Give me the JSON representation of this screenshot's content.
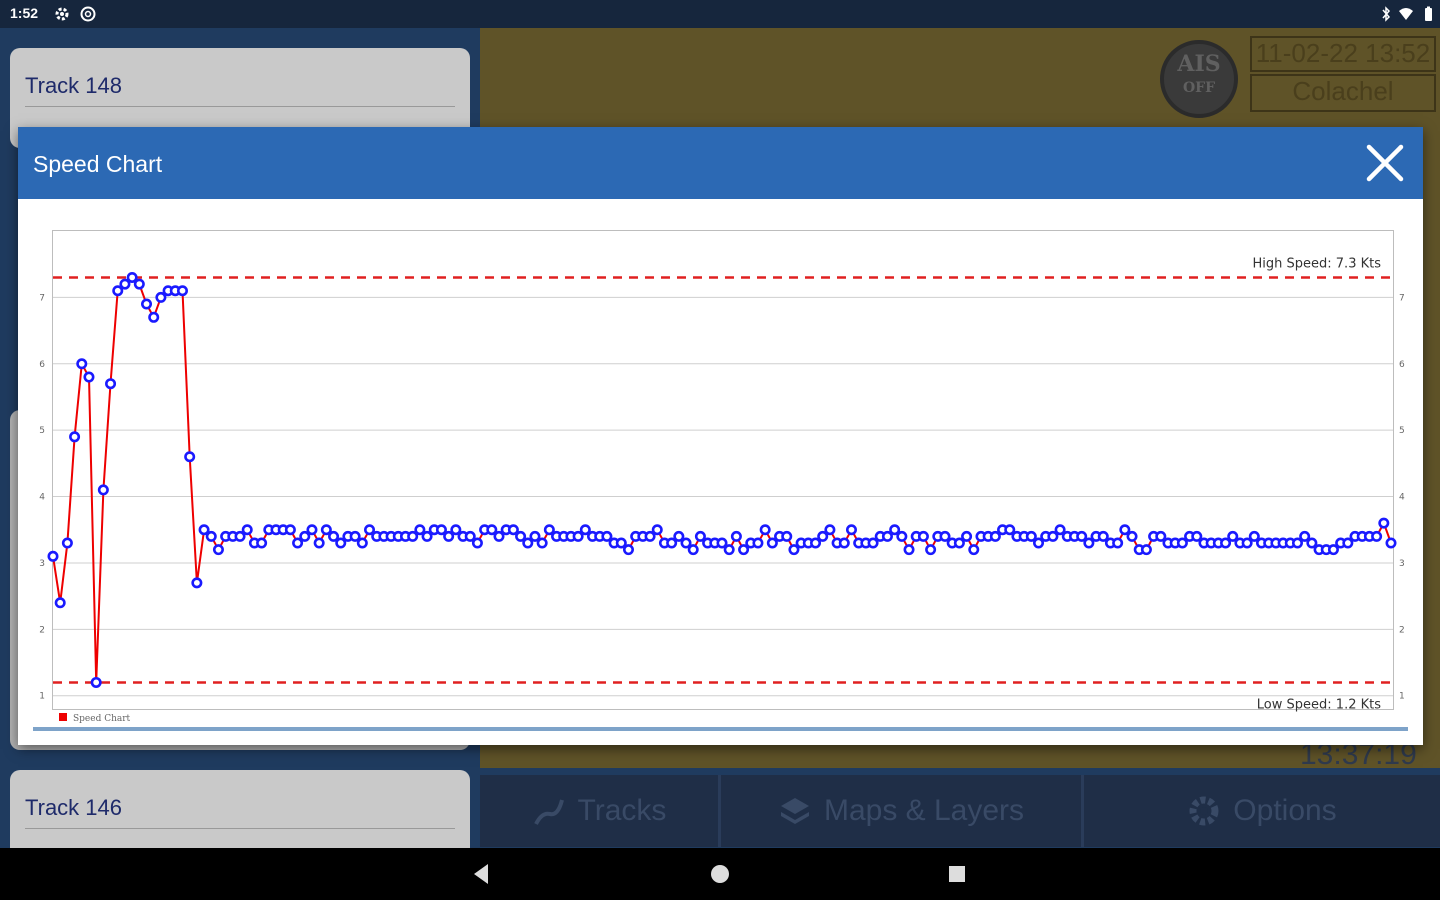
{
  "status_bar": {
    "time": "1:52",
    "left_icons": [
      "gear-icon",
      "at-icon"
    ],
    "right_icons": [
      "bluetooth-icon",
      "wifi-icon",
      "battery-icon"
    ]
  },
  "background": {
    "track_cards": [
      {
        "title": "Track 148"
      },
      {
        "title": "Track 146"
      }
    ],
    "ais_badge": {
      "line1": "AIS",
      "line2": "OFF"
    },
    "info_date": "11-02-22 13:52",
    "info_place": "Colachel",
    "bottom_time": "13:37:19",
    "nav_tabs": [
      {
        "label": "Tracks",
        "icon": "tracks-icon"
      },
      {
        "label": "Maps & Layers",
        "icon": "layers-icon"
      },
      {
        "label": "Options",
        "icon": "gear-icon"
      }
    ]
  },
  "dialog": {
    "title": "Speed Chart",
    "close_icon": "close-icon",
    "header_color": "#2c69b4"
  },
  "chart_data": {
    "type": "line",
    "ylim": [
      0.8,
      8.0
    ],
    "y_ticks": [
      "1",
      "2",
      "3",
      "4",
      "5",
      "6",
      "7"
    ],
    "grid": true,
    "legend": {
      "label": "Speed Chart",
      "placement": "bottom-left",
      "color": "#ee0000"
    },
    "line_color": "#ee0000",
    "marker_color": "#1a1aff",
    "reference_lines": [
      {
        "label": "High Speed: 7.3 Kts",
        "value": 7.3,
        "color": "#e02020"
      },
      {
        "label": "Low Speed: 1.2 Kts",
        "value": 1.2,
        "color": "#e02020"
      }
    ],
    "series": [
      {
        "values": [
          3.1,
          2.4,
          3.3,
          4.9,
          6.0,
          5.8,
          1.2,
          4.1,
          5.7,
          7.1,
          7.2,
          7.3,
          7.2,
          6.9,
          6.7,
          7.0,
          7.1,
          7.1,
          7.1,
          4.6,
          2.7,
          3.5,
          3.4,
          3.2,
          3.4,
          3.4,
          3.4,
          3.5,
          3.3,
          3.3,
          3.5,
          3.5,
          3.5,
          3.5,
          3.3,
          3.4,
          3.5,
          3.3,
          3.5,
          3.4,
          3.3,
          3.4,
          3.4,
          3.3,
          3.5,
          3.4,
          3.4,
          3.4,
          3.4,
          3.4,
          3.4,
          3.5,
          3.4,
          3.5,
          3.5,
          3.4,
          3.5,
          3.4,
          3.4,
          3.3,
          3.5,
          3.5,
          3.4,
          3.5,
          3.5,
          3.4,
          3.3,
          3.4,
          3.3,
          3.5,
          3.4,
          3.4,
          3.4,
          3.4,
          3.5,
          3.4,
          3.4,
          3.4,
          3.3,
          3.3,
          3.2,
          3.4,
          3.4,
          3.4,
          3.5,
          3.3,
          3.3,
          3.4,
          3.3,
          3.2,
          3.4,
          3.3,
          3.3,
          3.3,
          3.2,
          3.4,
          3.2,
          3.3,
          3.3,
          3.5,
          3.3,
          3.4,
          3.4,
          3.2,
          3.3,
          3.3,
          3.3,
          3.4,
          3.5,
          3.3,
          3.3,
          3.5,
          3.3,
          3.3,
          3.3,
          3.4,
          3.4,
          3.5,
          3.4,
          3.2,
          3.4,
          3.4,
          3.2,
          3.4,
          3.4,
          3.3,
          3.3,
          3.4,
          3.2,
          3.4,
          3.4,
          3.4,
          3.5,
          3.5,
          3.4,
          3.4,
          3.4,
          3.3,
          3.4,
          3.4,
          3.5,
          3.4,
          3.4,
          3.4,
          3.3,
          3.4,
          3.4,
          3.3,
          3.3,
          3.5,
          3.4,
          3.2,
          3.2,
          3.4,
          3.4,
          3.3,
          3.3,
          3.3,
          3.4,
          3.4,
          3.3,
          3.3,
          3.3,
          3.3,
          3.4,
          3.3,
          3.3,
          3.4,
          3.3,
          3.3,
          3.3,
          3.3,
          3.3,
          3.3,
          3.4,
          3.3,
          3.2,
          3.2,
          3.2,
          3.3,
          3.3,
          3.4,
          3.4,
          3.4,
          3.4,
          3.6,
          3.3
        ]
      }
    ]
  },
  "system_nav": {
    "back": "back-icon",
    "home": "home-icon",
    "recents": "recents-icon"
  }
}
